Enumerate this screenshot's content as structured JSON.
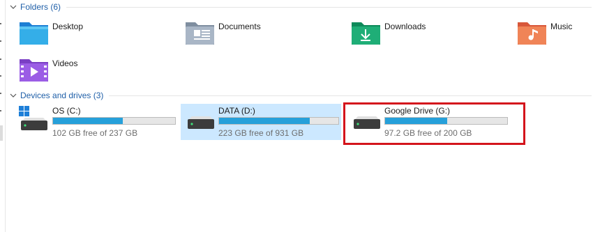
{
  "groups": {
    "folders": {
      "title": "Folders (6)"
    },
    "devices": {
      "title": "Devices and drives (3)"
    }
  },
  "folders": [
    {
      "label": "Desktop",
      "icon": "desktop-folder-icon"
    },
    {
      "label": "Documents",
      "icon": "documents-folder-icon"
    },
    {
      "label": "Downloads",
      "icon": "downloads-folder-icon"
    },
    {
      "label": "Music",
      "icon": "music-folder-icon"
    },
    {
      "label": "Videos",
      "icon": "videos-folder-icon"
    }
  ],
  "drives": [
    {
      "name": "OS (C:)",
      "free": "102 GB free of 237 GB",
      "used_fraction": 0.57,
      "icon": "os-drive-icon"
    },
    {
      "name": "DATA (D:)",
      "free": "223 GB free of 931 GB",
      "used_fraction": 0.76,
      "icon": "hard-drive-icon"
    },
    {
      "name": "Google Drive (G:)",
      "free": "97.2 GB free of 200 GB",
      "used_fraction": 0.51,
      "icon": "hard-drive-icon"
    }
  ],
  "colors": {
    "accent": "#1f5fa8",
    "bar_fill": "#26a0da",
    "bar_track": "#e6e6e6",
    "selection": "#cce8ff",
    "highlight": "#d4141c"
  }
}
